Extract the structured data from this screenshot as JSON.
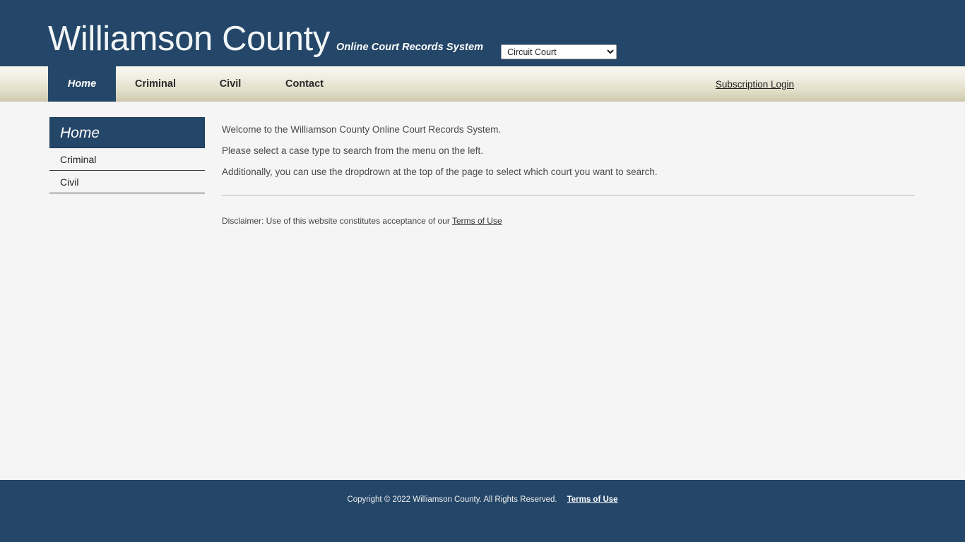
{
  "header": {
    "site_title": "Williamson County",
    "subtitle": "Online Court Records System",
    "court_select": {
      "selected": "Circuit Court",
      "options": [
        "Circuit Court"
      ]
    },
    "background_color": "#244668"
  },
  "nav": {
    "items": [
      {
        "label": "Home",
        "active": true
      },
      {
        "label": "Criminal",
        "active": false
      },
      {
        "label": "Civil",
        "active": false
      },
      {
        "label": "Contact",
        "active": false
      }
    ],
    "subscription_login": "Subscription Login"
  },
  "sidebar": {
    "header": "Home",
    "items": [
      {
        "label": "Criminal"
      },
      {
        "label": "Civil"
      }
    ]
  },
  "main": {
    "paragraphs": [
      "Welcome to the Williamson County Online Court Records System.",
      "Please select a case type to search from the menu on the left.",
      "Additionally, you can use the dropdrown at the top of the page to select which court you want to search."
    ],
    "disclaimer_prefix": "Disclaimer: Use of this website constitutes acceptance of our ",
    "disclaimer_link": "Terms of Use"
  },
  "footer": {
    "copyright": "Copyright © 2022 Williamson County. All Rights Reserved.",
    "terms_link": "Terms of Use"
  }
}
